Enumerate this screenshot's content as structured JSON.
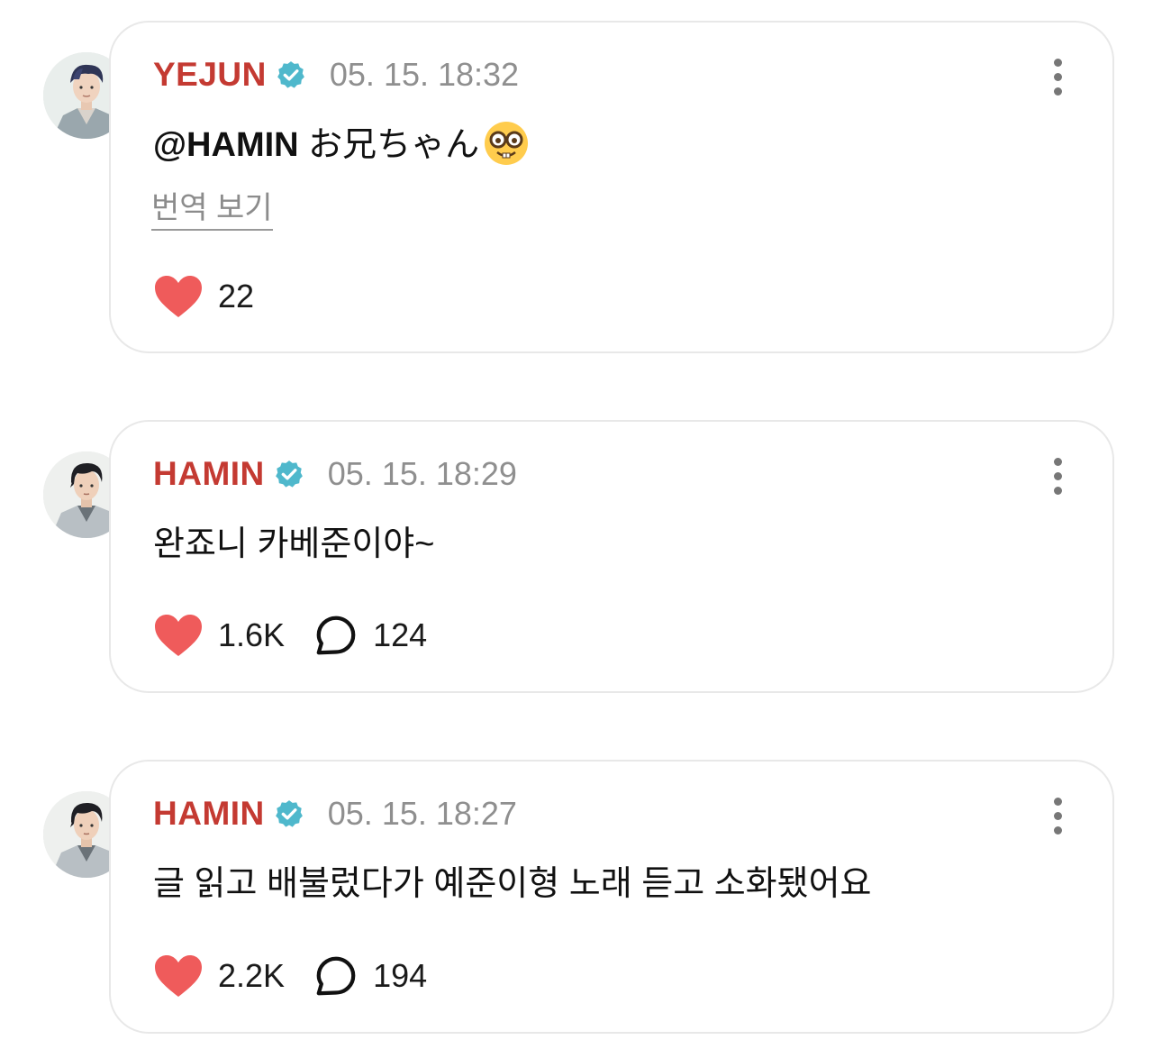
{
  "posts": [
    {
      "username": "YEJUN",
      "timestamp": "05. 15. 18:32",
      "mention": "@HAMIN",
      "text": " お兄ちゃん",
      "emoji": "nerd-face-emoji",
      "translate_label": "번역 보기",
      "likes": "22"
    },
    {
      "username": "HAMIN",
      "timestamp": "05. 15. 18:29",
      "text": "완죠니 카베준이야~",
      "likes": "1.6K",
      "comments": "124"
    },
    {
      "username": "HAMIN",
      "timestamp": "05. 15. 18:27",
      "text": "글 읽고 배불렀다가 예준이형 노래 듣고 소화됐어요",
      "likes": "2.2K",
      "comments": "194"
    }
  ],
  "icons": {
    "verified": "verified-badge-icon",
    "more": "more-vertical-icon",
    "like": "heart-icon",
    "comment": "comment-bubble-icon"
  },
  "colors": {
    "username": "#c43a32",
    "verified": "#4fb8cc",
    "heart": "#ef5b5b",
    "timestamp": "#8f8f8f"
  }
}
